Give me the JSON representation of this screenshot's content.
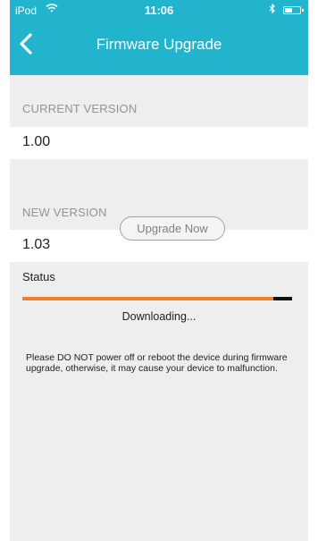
{
  "status_bar": {
    "carrier": "iPod",
    "time": "11:06"
  },
  "nav": {
    "title": "Firmware Upgrade"
  },
  "current_version": {
    "label": "CURRENT VERSION",
    "value": "1.00"
  },
  "new_version": {
    "label": "NEW VERSION",
    "value": "1.03"
  },
  "upgrade_button": {
    "label": "Upgrade Now"
  },
  "status": {
    "label": "Status",
    "progress_percent": 93,
    "text": "Downloading..."
  },
  "warning": {
    "text": "Please DO NOT power off or reboot the device during firmware upgrade, otherwise, it may cause your device to malfunction."
  },
  "colors": {
    "header": "#23b4cd",
    "progress": "#f07f28",
    "background": "#eeeeef"
  },
  "icons": [
    "wifi-icon",
    "bluetooth-icon",
    "battery-icon",
    "back-chevron-icon"
  ]
}
